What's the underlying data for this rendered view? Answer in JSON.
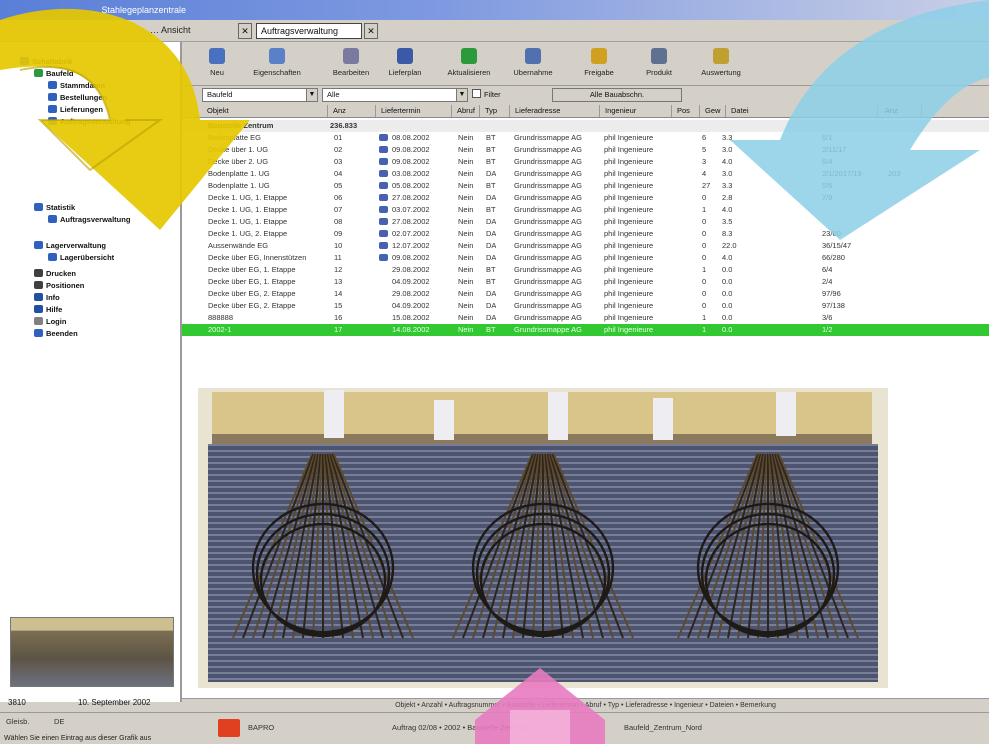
{
  "window": {
    "title": "… Stahlegeplanzentrale",
    "menu_text": "… Ansicht",
    "active_tab": "Auftragsverwaltung",
    "close_glyph": "✕"
  },
  "sidebar": {
    "items": [
      {
        "label": "Schalfabrik",
        "icon": "folder-icon"
      },
      {
        "label": "Baufeld",
        "icon": "folder-icon"
      },
      {
        "label": "Stammdaten",
        "icon": "folder-icon"
      },
      {
        "label": "Bestellungen",
        "icon": "folder-icon"
      },
      {
        "label": "Lieferungen",
        "icon": "folder-icon"
      },
      {
        "label": "Auftragsverwaltung",
        "icon": "folder-icon"
      },
      {
        "label": "Statistik",
        "icon": "chart-icon"
      },
      {
        "label": "Auftragsverwaltung",
        "icon": "folder-icon"
      },
      {
        "label": "Lagerverwaltung",
        "icon": "box-icon"
      },
      {
        "label": "Lagerübersicht",
        "icon": "list-icon"
      },
      {
        "label": "Drucken",
        "icon": "printer-icon"
      },
      {
        "label": "Positionen",
        "icon": "list-icon"
      },
      {
        "label": "Info",
        "icon": "info-icon"
      },
      {
        "label": "Hilfe",
        "icon": "help-icon"
      },
      {
        "label": "Login",
        "icon": "key-icon"
      },
      {
        "label": "Beenden",
        "icon": "exit-icon"
      }
    ],
    "status": {
      "left": "3810",
      "right": "10. September 2002"
    }
  },
  "toolbar": {
    "buttons": [
      {
        "label": "Neu",
        "icon": "new-doc-icon"
      },
      {
        "label": "Eigenschaften",
        "icon": "properties-icon"
      },
      {
        "label": "Bearbeiten",
        "icon": "edit-icon"
      },
      {
        "label": "Lieferplan",
        "icon": "calendar-icon"
      },
      {
        "label": "Aktualisieren",
        "icon": "refresh-icon"
      },
      {
        "label": "Ubernahme",
        "icon": "import-icon"
      },
      {
        "label": "Freigabe",
        "icon": "release-icon"
      },
      {
        "label": "Produkt",
        "icon": "gear-icon"
      },
      {
        "label": "Auswertung",
        "icon": "report-icon"
      }
    ]
  },
  "filters": {
    "select_1": "Baufeld",
    "select_2": "Alle",
    "checkbox_label": "Filter",
    "path_label": "Alle Bauabschn."
  },
  "grid": {
    "headers": [
      "Objekt",
      "Anz",
      "Liefertermin",
      "Abruf",
      "Typ",
      "Lieferadresse",
      "Ingenieur",
      "Pos",
      "Gew",
      "Datei",
      "Anz"
    ],
    "group_row": {
      "label": "Baustelle Zentrum",
      "value": "236.833"
    },
    "rows": [
      {
        "name": "Bodenplatte EG",
        "n": "01",
        "date": "08.08.2002",
        "a": "Nein",
        "t": "BT",
        "addr": "Grundrissmappe AG",
        "eng": "phil Ingenieure",
        "p": "6",
        "w": "3.3",
        "f": "6/1",
        "x": ""
      },
      {
        "name": "Decke über 1. UG",
        "n": "02",
        "date": "09.08.2002",
        "a": "Nein",
        "t": "BT",
        "addr": "Grundrissmappe AG",
        "eng": "phil Ingenieure",
        "p": "5",
        "w": "3.0",
        "f": "2/11/17",
        "x": ""
      },
      {
        "name": "Decke über 2. UG",
        "n": "03",
        "date": "09.08.2002",
        "a": "Nein",
        "t": "BT",
        "addr": "Grundrissmappe AG",
        "eng": "phil Ingenieure",
        "p": "3",
        "w": "4.0",
        "f": "6/4",
        "x": ""
      },
      {
        "name": "Bodenplatte 1. UG",
        "n": "04",
        "date": "03.08.2002",
        "a": "Nein",
        "t": "DA",
        "addr": "Grundrissmappe AG",
        "eng": "phil Ingenieure",
        "p": "4",
        "w": "3.0",
        "f": "2/1/2017/19",
        "x": "203"
      },
      {
        "name": "Bodenplatte 1. UG",
        "n": "05",
        "date": "05.08.2002",
        "a": "Nein",
        "t": "BT",
        "addr": "Grundrissmappe AG",
        "eng": "phil Ingenieure",
        "p": "27",
        "w": "3.3",
        "f": "5/6",
        "x": ""
      },
      {
        "name": "Decke 1. UG, 1. Etappe",
        "n": "06",
        "date": "27.08.2002",
        "a": "Nein",
        "t": "DA",
        "addr": "Grundrissmappe AG",
        "eng": "phil Ingenieure",
        "p": "0",
        "w": "2.8",
        "f": "7/9",
        "x": ""
      },
      {
        "name": "Decke 1. UG, 1. Etappe",
        "n": "07",
        "date": "03.07.2002",
        "a": "Nein",
        "t": "BT",
        "addr": "Grundrissmappe AG",
        "eng": "phil Ingenieure",
        "p": "1",
        "w": "4.0",
        "f": "",
        "x": ""
      },
      {
        "name": "Decke 1. UG, 1. Etappe",
        "n": "08",
        "date": "27.08.2002",
        "a": "Nein",
        "t": "DA",
        "addr": "Grundrissmappe AG",
        "eng": "phil Ingenieure",
        "p": "0",
        "w": "3.5",
        "f": "",
        "x": ""
      },
      {
        "name": "Decke 1. UG, 2. Etappe",
        "n": "09",
        "date": "02.07.2002",
        "a": "Nein",
        "t": "DA",
        "addr": "Grundrissmappe AG",
        "eng": "phil Ingenieure",
        "p": "0",
        "w": "8.3",
        "f": "23/60",
        "x": ""
      },
      {
        "name": "Aussenwände EG",
        "n": "10",
        "date": "12.07.2002",
        "a": "Nein",
        "t": "DA",
        "addr": "Grundrissmappe AG",
        "eng": "phil Ingenieure",
        "p": "0",
        "w": "22.0",
        "f": "36/15/47",
        "x": ""
      },
      {
        "name": "Decke über EG, Innenstützen",
        "n": "11",
        "date": "09.08.2002",
        "a": "Nein",
        "t": "DA",
        "addr": "Grundrissmappe AG",
        "eng": "phil Ingenieure",
        "p": "0",
        "w": "4.0",
        "f": "66/280",
        "x": ""
      },
      {
        "name": "Decke über EG, 1. Etappe",
        "n": "12",
        "date": "29.08.2002",
        "a": "Nein",
        "t": "BT",
        "addr": "Grundrissmappe AG",
        "eng": "phil Ingenieure",
        "p": "1",
        "w": "0.0",
        "f": "6/4",
        "x": ""
      },
      {
        "name": "Decke über EG, 1. Etappe",
        "n": "13",
        "date": "04.09.2002",
        "a": "Nein",
        "t": "BT",
        "addr": "Grundrissmappe AG",
        "eng": "phil Ingenieure",
        "p": "0",
        "w": "0.0",
        "f": "2/4",
        "x": ""
      },
      {
        "name": "Decke über EG, 2. Etappe",
        "n": "14",
        "date": "29.08.2002",
        "a": "Nein",
        "t": "DA",
        "addr": "Grundrissmappe AG",
        "eng": "phil Ingenieure",
        "p": "0",
        "w": "0.0",
        "f": "97/96",
        "x": ""
      },
      {
        "name": "Decke über EG, 2. Etappe",
        "n": "15",
        "date": "04.09.2002",
        "a": "Nein",
        "t": "DA",
        "addr": "Grundrissmappe AG",
        "eng": "phil Ingenieure",
        "p": "0",
        "w": "0.0",
        "f": "97/138",
        "x": ""
      },
      {
        "name": "888888",
        "n": "16",
        "date": "15.08.2002",
        "a": "Nein",
        "t": "DA",
        "addr": "Grundrissmappe AG",
        "eng": "phil Ingenieure",
        "p": "1",
        "w": "0.0",
        "f": "3/6",
        "x": ""
      },
      {
        "name": "2002-1",
        "n": "17",
        "date": "14.08.2002",
        "a": "Nein",
        "t": "BT",
        "addr": "Grundrissmappe AG",
        "eng": "phil Ingenieure",
        "p": "1",
        "w": "0.0",
        "f": "1/2",
        "x": "",
        "selected": true
      }
    ]
  },
  "status_bar": {
    "text": "Objekt • Anzahl • Auftragsnummer • Baustelle • Liefertermin • Abruf • Typ • Lieferadresse • Ingenieur • Dateien • Bemerkung"
  },
  "taskbar": {
    "left_status": "Gleisb.",
    "left_status_2": "DE",
    "app_label": "BAPRO",
    "middle_text": "Auftrag 02/08 • 2002 • Baustelle Zentrum",
    "right_text": "Baufeld_Zentrum_Nord",
    "hint": "Wählen Sie einen Eintrag aus dieser Grafik aus"
  },
  "colors": {
    "selection": "#32c832",
    "titlebar": "#5a7fd8",
    "arrow_yellow": "#e6c800",
    "arrow_blue": "#8ccfe8",
    "arrow_pink": "#e87ac0"
  }
}
